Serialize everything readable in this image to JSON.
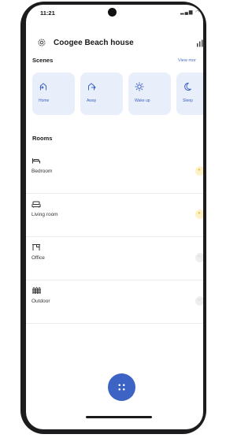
{
  "status_bar": {
    "time": "11:21"
  },
  "header": {
    "title": "Coogee Beach house"
  },
  "scenes": {
    "title": "Scenes",
    "view_more": "View mor",
    "items": [
      {
        "label": "Home",
        "icon": "home-enter-icon"
      },
      {
        "label": "Away",
        "icon": "leave-icon"
      },
      {
        "label": "Wake up",
        "icon": "sun-icon"
      },
      {
        "label": "Sleep",
        "icon": "moon-icon"
      }
    ]
  },
  "rooms": {
    "title": "Rooms",
    "items": [
      {
        "label": "Bedroom",
        "icon": "bed-icon",
        "light_on": true
      },
      {
        "label": "Living room",
        "icon": "sofa-icon",
        "light_on": true
      },
      {
        "label": "Office",
        "icon": "desk-icon",
        "light_on": false
      },
      {
        "label": "Outdoor",
        "icon": "fence-icon",
        "light_on": false
      }
    ]
  },
  "colors": {
    "accent": "#3d64c4",
    "scene_card_bg": "#e8eefa",
    "light_on_bg": "#fdf1c7",
    "light_on_icon": "#f5c542",
    "light_off_bg": "#eeeeee"
  }
}
